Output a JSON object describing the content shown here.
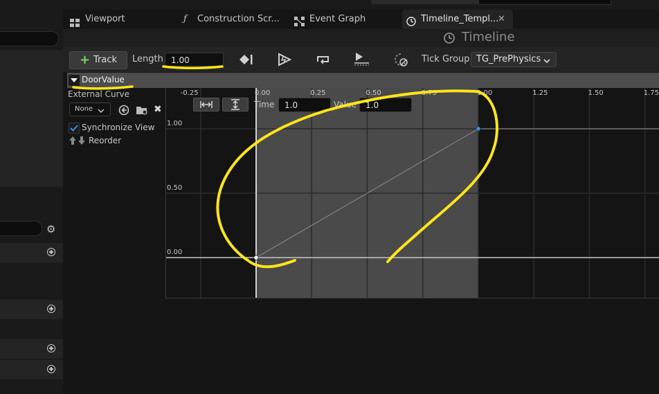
{
  "tabs": [
    {
      "label": "Viewport",
      "icon": "viewport-grid-icon"
    },
    {
      "label": "Construction Scr...",
      "icon": "function-icon"
    },
    {
      "label": "Event Graph",
      "icon": "event-graph-icon"
    },
    {
      "label": "Timeline_Templ...",
      "icon": "clock-icon"
    }
  ],
  "window_title": "Timeline",
  "toolbar": {
    "track_label": "Track",
    "length_label": "Length",
    "length_value": "1.00",
    "tick_group_label": "Tick Group",
    "tick_group_value": "TG_PrePhysics"
  },
  "track": {
    "name": "DoorValue",
    "external_curve_label": "External Curve",
    "curve_value": "None",
    "sync_view_label": "Synchronize View",
    "reorder_label": "Reorder"
  },
  "curve_editor": {
    "time_label": "Time",
    "time_value": "1.0",
    "value_label": "Value",
    "value_value": "1.0",
    "x_ticks": [
      "-0.25",
      "0.00",
      "0.25",
      "0.50",
      "0.75",
      "1.00",
      "1.25",
      "1.50",
      "1.75"
    ],
    "y_ticks": [
      "1.00",
      "0.50",
      "0.00"
    ],
    "keys": [
      {
        "time": 0.0,
        "value": 0.0
      },
      {
        "time": 1.0,
        "value": 1.0
      }
    ]
  },
  "colors": {
    "accent_plus": "#7fd46b",
    "checkbox": "#2a7fd4",
    "key_selected": "#3a8ee6",
    "annotation": "#ffe51a"
  }
}
